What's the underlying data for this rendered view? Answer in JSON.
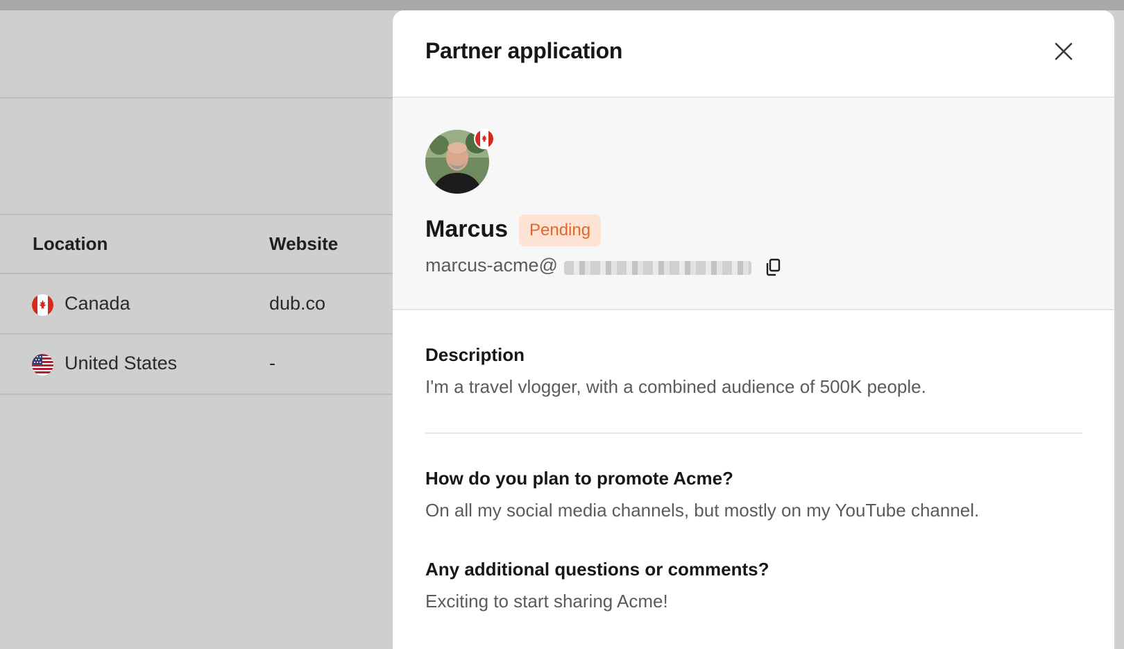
{
  "background": {
    "table": {
      "headers": [
        "Location",
        "Website"
      ],
      "rows": [
        {
          "location": "Canada",
          "location_flag_icon": "canada-flag-icon",
          "website": "dub.co"
        },
        {
          "location": "United States",
          "location_flag_icon": "usa-flag-icon",
          "website": "-"
        }
      ]
    }
  },
  "panel": {
    "title": "Partner application",
    "close_icon": "close-icon",
    "partner": {
      "name": "Marcus",
      "status": "Pending",
      "email_visible": "marcus-acme@",
      "email_domain_redacted": true,
      "flag_icon": "canada-flag-icon",
      "copy_icon": "copy-icon"
    },
    "sections": [
      {
        "heading": "Description",
        "body": "I'm a travel vlogger, with a combined audience of 500K people."
      },
      {
        "heading": "How do you plan to promote Acme?",
        "body": "On all my social media channels, but mostly on my YouTube channel."
      },
      {
        "heading": "Any additional questions or comments?",
        "body": "Exciting to start sharing Acme!"
      }
    ]
  },
  "colors": {
    "overlay_bg": "#cfcfcf",
    "panel_bg": "#ffffff",
    "profile_bg": "#f7f7f7",
    "badge_bg": "#fde3d3",
    "badge_text": "#e2672f"
  }
}
